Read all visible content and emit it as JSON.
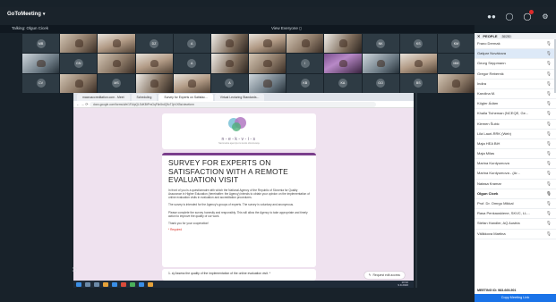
{
  "app": {
    "brand": "GoToMeeting",
    "talking": "Talking: Olgun Cicek",
    "view": "View Everyone"
  },
  "gallery": [
    {
      "initials": "MB",
      "video": false
    },
    {
      "initials": "",
      "video": true,
      "tone": "a"
    },
    {
      "initials": "",
      "video": true,
      "tone": "b"
    },
    {
      "initials": "DZ",
      "video": false
    },
    {
      "initials": "A",
      "video": false
    },
    {
      "initials": "",
      "video": true,
      "tone": "c"
    },
    {
      "initials": "",
      "video": true,
      "tone": "b"
    },
    {
      "initials": "",
      "video": true,
      "tone": "a"
    },
    {
      "initials": "",
      "video": true,
      "tone": "c"
    },
    {
      "initials": "NK",
      "video": false
    },
    {
      "initials": "KS",
      "video": false
    },
    {
      "initials": "KM",
      "video": false
    },
    {
      "initials": "",
      "video": true,
      "tone": "e"
    },
    {
      "initials": "GN",
      "video": false
    },
    {
      "initials": "",
      "video": true,
      "tone": "a"
    },
    {
      "initials": "",
      "video": true,
      "tone": "b"
    },
    {
      "initials": "A",
      "video": false
    },
    {
      "initials": "",
      "video": true,
      "tone": "c"
    },
    {
      "initials": "",
      "video": true,
      "tone": "a"
    },
    {
      "initials": "I",
      "video": false
    },
    {
      "initials": "",
      "video": true,
      "tone": "d"
    },
    {
      "initials": "",
      "video": true,
      "tone": "e"
    },
    {
      "initials": "",
      "video": true,
      "tone": "b"
    },
    {
      "initials": "MM",
      "video": false
    },
    {
      "initials": "CV",
      "video": false
    },
    {
      "initials": "",
      "video": true,
      "tone": "a"
    },
    {
      "initials": "MS",
      "video": false
    },
    {
      "initials": "",
      "video": true,
      "tone": "c"
    },
    {
      "initials": "",
      "video": true,
      "tone": "b"
    },
    {
      "initials": "A",
      "video": false
    },
    {
      "initials": "",
      "video": true,
      "tone": "e"
    },
    {
      "initials": "KB",
      "video": false
    },
    {
      "initials": "KA",
      "video": false
    },
    {
      "initials": "GO",
      "video": false
    },
    {
      "initials": "BS",
      "video": false
    },
    {
      "initials": "",
      "video": true,
      "tone": "a"
    }
  ],
  "browser": {
    "tabs": [
      "macroaccreditation.com - Meet",
      "Scheduling",
      "Survey for Experts on Satisfac...",
      "Virtual Lecturing Standards..."
    ],
    "url": "docs.google.com/forms/d/e/1FAIpQLSdKBtPmOqF6n5rdQ9cT2pVXBs/viewform"
  },
  "form": {
    "logo_name": "n-e-k-v-i-s",
    "logo_sub": "Nacionalna agencija za visoko obrazovanje",
    "title": "SURVEY FOR EXPERTS ON SATISFACTION WITH A REMOTE EVALUATION VISIT",
    "para1": "In front of you is a questionnaire with which the National Agency of the Republic of Slovenia for Quality Assurance in Higher Education (hereinafter: the Agency) intends to obtain your opinion on the implementation of online evaluation visits in evaluation and accreditation procedures.",
    "para2": "The survey is intended for the Agency's groups of experts. The survey is voluntary and anonymous.",
    "para3": "Please complete the survey honestly and responsibly. This will allow the Agency to take appropriate and timely action to improve the quality of our work.",
    "para4": "Thank you for your cooperation!",
    "required": "* Required",
    "question": "1. a) Assess the quality of the implementation of the online evaluation visit. *",
    "request_button": "Request edit access"
  },
  "taskbar": {
    "time": "10:32",
    "date": "9.9.2020"
  },
  "people": {
    "header": "PEOPLE",
    "count": "36/250",
    "list": [
      {
        "name": "Frano Dermak",
        "sel": false,
        "bold": false
      },
      {
        "name": "Gašpar Novákova",
        "sel": true,
        "bold": false
      },
      {
        "name": "Georg Seppmann",
        "sel": false,
        "bold": false
      },
      {
        "name": "Gregor Rebernik",
        "sel": false,
        "bold": false
      },
      {
        "name": "Indira",
        "sel": false,
        "bold": false
      },
      {
        "name": "Karolina M.",
        "sel": false,
        "bold": false
      },
      {
        "name": "Kögler Ádám",
        "sel": false,
        "bold": false
      },
      {
        "name": "Khalla Ticheman (NCEQE, Ge...",
        "sel": false,
        "bold": false
      },
      {
        "name": "Klemen Šubic",
        "sel": false,
        "bold": false
      },
      {
        "name": "Lilá Lauri-RRK (Web)",
        "sel": false,
        "bold": false
      },
      {
        "name": "Maja HEA BiH",
        "sel": false,
        "bold": false
      },
      {
        "name": "Maja Milas",
        "sel": false,
        "bold": false
      },
      {
        "name": "Marina Kurdyumova",
        "sel": false,
        "bold": false
      },
      {
        "name": "Marina Kurdyumova - (Ar...",
        "sel": false,
        "bold": false
      },
      {
        "name": "Natasa Kramar",
        "sel": false,
        "bold": false
      },
      {
        "name": "Olgun Cicek",
        "sel": false,
        "bold": true
      },
      {
        "name": "Prof. Dr. Omrgu Mikkal",
        "sel": false,
        "bold": false
      },
      {
        "name": "Rasa Penkauskiene, SKVC, LL...",
        "sel": false,
        "bold": false
      },
      {
        "name": "Stefan Handler, AQ Austria",
        "sel": false,
        "bold": false
      },
      {
        "name": "Välikkova Martina",
        "sel": false,
        "bold": false
      }
    ],
    "meeting_id": "MEETING ID: 983-669-501",
    "copy_button": "Copy Meeting Link"
  }
}
